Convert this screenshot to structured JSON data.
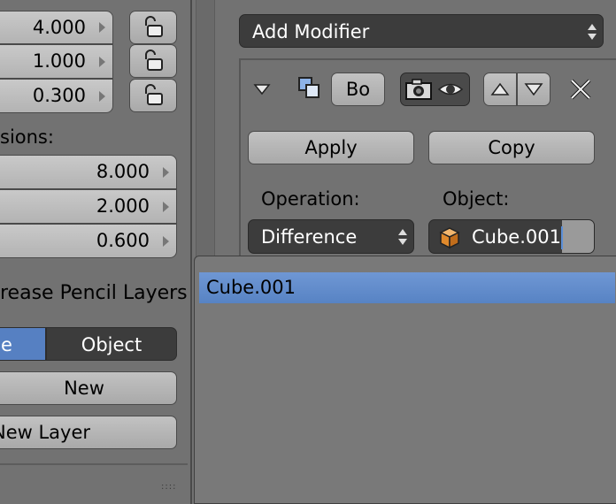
{
  "left_panel": {
    "scale_values": [
      "4.000",
      "1.000",
      "0.300"
    ],
    "dimensions_label": "sions:",
    "dimension_values": [
      "8.000",
      "2.000",
      "0.600"
    ],
    "grease_header": "rease Pencil Layers",
    "scene_tab": "e",
    "object_tab": "Object",
    "new_button": "New",
    "new_layer_button": "New Layer"
  },
  "modifier": {
    "add_modifier": "Add Modifier",
    "name_value": "Bo",
    "apply": "Apply",
    "copy": "Copy",
    "operation_label": "Operation:",
    "object_label": "Object:",
    "operation_value": "Difference",
    "object_value": "Cube.001"
  },
  "dropdown": {
    "items": [
      "Cube.001"
    ]
  },
  "colors": {
    "accent": "#6a93d4",
    "panel": "#727272",
    "dark_field": "#3c3c3c"
  }
}
